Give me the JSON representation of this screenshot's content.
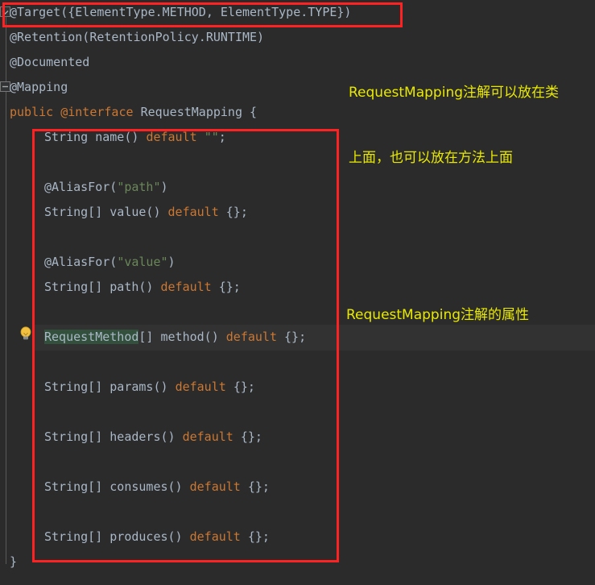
{
  "editor": {
    "theme": "darcula",
    "background": "#2b2b2b",
    "current_line_background": "#323232",
    "default_text_color": "#a9b7c6",
    "keyword_color": "#cc7832",
    "string_color": "#6a8759",
    "identifier_highlight_color": "#32503c",
    "annotation_box_color": "#ff2222",
    "callout_color": "#e9e900"
  },
  "gutter": {
    "fold_marker_expanded": "fold-expanded-icon",
    "fold_marker_end": "fold-end-icon",
    "intention_bulb": "lightbulb-icon"
  },
  "code_lines": [
    {
      "n": 1,
      "indent": "root",
      "tokens": [
        {
          "t": "@Target(",
          "c": "ident"
        },
        {
          "t": "{ElementType.METHOD, ElementType.TYPE}",
          "c": "ident"
        },
        {
          "t": ")",
          "c": "ident"
        }
      ]
    },
    {
      "n": 2,
      "indent": "root",
      "tokens": [
        {
          "t": "@Retention(RetentionPolicy.RUNTIME)",
          "c": "ident"
        }
      ]
    },
    {
      "n": 3,
      "indent": "root",
      "tokens": [
        {
          "t": "@Documented",
          "c": "ident"
        }
      ]
    },
    {
      "n": 4,
      "indent": "root",
      "tokens": [
        {
          "t": "@Mapping",
          "c": "ident"
        }
      ]
    },
    {
      "n": 5,
      "indent": "root",
      "tokens": [
        {
          "t": "public ",
          "c": "kw"
        },
        {
          "t": "@interface ",
          "c": "kw"
        },
        {
          "t": "RequestMapping ",
          "c": "ident"
        },
        {
          "t": "{",
          "c": "brace"
        }
      ]
    },
    {
      "n": 6,
      "indent": "indent",
      "tokens": [
        {
          "t": "String name() ",
          "c": "ident"
        },
        {
          "t": "default ",
          "c": "kw"
        },
        {
          "t": "\"\"",
          "c": "str"
        },
        {
          "t": ";",
          "c": "ident"
        }
      ]
    },
    {
      "n": 7,
      "indent": "indent",
      "tokens": []
    },
    {
      "n": 8,
      "indent": "indent",
      "tokens": [
        {
          "t": "@AliasFor(",
          "c": "ident"
        },
        {
          "t": "\"path\"",
          "c": "str"
        },
        {
          "t": ")",
          "c": "ident"
        }
      ]
    },
    {
      "n": 9,
      "indent": "indent",
      "tokens": [
        {
          "t": "String[] value() ",
          "c": "ident"
        },
        {
          "t": "default ",
          "c": "kw"
        },
        {
          "t": "{};",
          "c": "ident"
        }
      ]
    },
    {
      "n": 10,
      "indent": "indent",
      "tokens": []
    },
    {
      "n": 11,
      "indent": "indent",
      "tokens": [
        {
          "t": "@AliasFor(",
          "c": "ident"
        },
        {
          "t": "\"value\"",
          "c": "str"
        },
        {
          "t": ")",
          "c": "ident"
        }
      ]
    },
    {
      "n": 12,
      "indent": "indent",
      "tokens": [
        {
          "t": "String[] path() ",
          "c": "ident"
        },
        {
          "t": "default ",
          "c": "kw"
        },
        {
          "t": "{};",
          "c": "ident"
        }
      ]
    },
    {
      "n": 13,
      "indent": "indent",
      "tokens": []
    },
    {
      "n": 14,
      "indent": "indent",
      "current": true,
      "tokens": [
        {
          "t": "RequestMethod",
          "c": "ident hl"
        },
        {
          "t": "[] method() ",
          "c": "ident"
        },
        {
          "t": "default ",
          "c": "kw"
        },
        {
          "t": "{};",
          "c": "ident"
        }
      ]
    },
    {
      "n": 15,
      "indent": "indent",
      "tokens": []
    },
    {
      "n": 16,
      "indent": "indent",
      "tokens": [
        {
          "t": "String[] params() ",
          "c": "ident"
        },
        {
          "t": "default ",
          "c": "kw"
        },
        {
          "t": "{};",
          "c": "ident"
        }
      ]
    },
    {
      "n": 17,
      "indent": "indent",
      "tokens": []
    },
    {
      "n": 18,
      "indent": "indent",
      "tokens": [
        {
          "t": "String[] headers() ",
          "c": "ident"
        },
        {
          "t": "default ",
          "c": "kw"
        },
        {
          "t": "{};",
          "c": "ident"
        }
      ]
    },
    {
      "n": 19,
      "indent": "indent",
      "tokens": []
    },
    {
      "n": 20,
      "indent": "indent",
      "tokens": [
        {
          "t": "String[] consumes() ",
          "c": "ident"
        },
        {
          "t": "default ",
          "c": "kw"
        },
        {
          "t": "{};",
          "c": "ident"
        }
      ]
    },
    {
      "n": 21,
      "indent": "indent",
      "tokens": []
    },
    {
      "n": 22,
      "indent": "indent",
      "tokens": [
        {
          "t": "String[] produces() ",
          "c": "ident"
        },
        {
          "t": "default ",
          "c": "kw"
        },
        {
          "t": "{};",
          "c": "ident"
        }
      ]
    },
    {
      "n": 23,
      "indent": "root",
      "tokens": [
        {
          "t": "}",
          "c": "brace"
        }
      ]
    }
  ],
  "annotations": {
    "callout_1_line_1": "RequestMapping注解可以放在类",
    "callout_1_line_2": "上面，也可以放在方法上面",
    "callout_2": "RequestMapping注解的属性"
  }
}
